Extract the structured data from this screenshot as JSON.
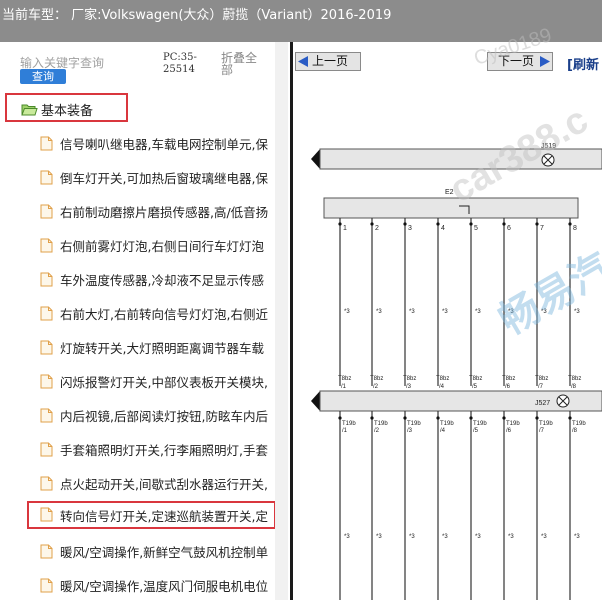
{
  "header": {
    "title": "当前车型：  厂家:Volkswagen(大众）蔚揽（Variant）2016-2019"
  },
  "search": {
    "placeholder": "输入关键字查询",
    "button": "查询",
    "pc_code": "PC:35-25514",
    "collapse_all": "折叠全部"
  },
  "tree": {
    "root": "基本装备",
    "items": [
      "信号喇叭继电器,车载电网控制单元,保",
      "倒车灯开关,可加热后窗玻璃继电器,保",
      "右前制动磨擦片磨损传感器,高/低音扬",
      "右侧前雾灯灯泡,右侧日间行车灯灯泡",
      "车外温度传感器,冷却液不足显示传感",
      "右前大灯,右前转向信号灯灯泡,右侧近",
      "灯旋转开关,大灯照明距离调节器车载",
      "闪烁报警灯开关,中部仪表板开关模块,",
      "内后视镜,后部阅读灯按钮,防眩车内后",
      "手套箱照明灯开关,行李厢照明灯,手套",
      "点火起动开关,间歇式刮水器运行开关,",
      "转向信号灯开关,定速巡航装置开关,定",
      "暖风/空调操作,新鲜空气鼓风机控制单",
      "暖风/空调操作,温度风门伺服电机电位"
    ]
  },
  "viewer": {
    "prev": "上一页",
    "next": "下一页",
    "refresh": "[刷新",
    "watermarks": [
      "car388.c",
      "畅易汽",
      "Cya0189"
    ]
  },
  "diagram": {
    "top_relay": "J519",
    "top_component": "E2",
    "pins_top": [
      "1",
      "2",
      "3",
      "4",
      "5",
      "6",
      "7",
      "8"
    ],
    "wire_label": "*3",
    "connector_labels": [
      "T8bz",
      "T8bz",
      "T8bz",
      "T8bz",
      "T8bz",
      "T8bz",
      "T8bz",
      "T8bz"
    ],
    "connector_pins": [
      "/1",
      "/2",
      "/3",
      "/4",
      "/5",
      "/6",
      "/7",
      "/8"
    ],
    "bottom_module": "J527",
    "lower_labels": [
      "T19b",
      "T19b",
      "T19b",
      "T19b",
      "T19b",
      "T19b",
      "T19b",
      "T19b"
    ],
    "lower_pins": [
      "/1",
      "/2",
      "/3",
      "/4",
      "/5",
      "/6",
      "/7",
      "/8"
    ]
  },
  "colors": {
    "topbar": "#8c8c8c",
    "search_button": "#2f7ed8",
    "highlight_border": "#d9363e",
    "pager_arrow": "#2a5cc5"
  }
}
